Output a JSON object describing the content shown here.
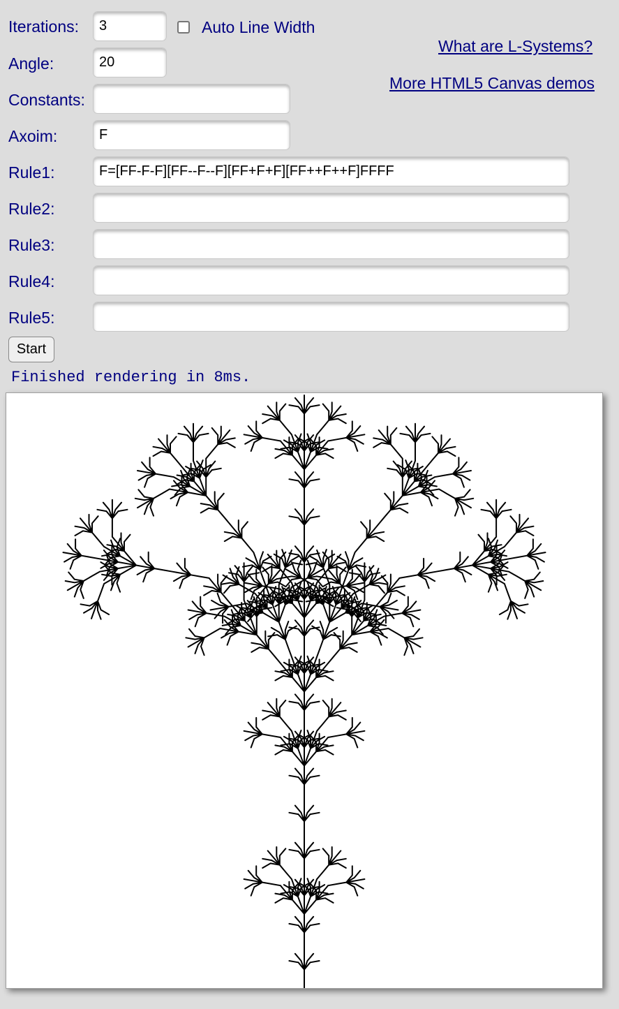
{
  "form": {
    "iterations": {
      "label": "Iterations:",
      "value": "3"
    },
    "angle": {
      "label": "Angle:",
      "value": "20"
    },
    "constants": {
      "label": "Constants:",
      "value": ""
    },
    "axiom": {
      "label": "Axoim:",
      "value": "F"
    },
    "rules": [
      {
        "label": "Rule1:",
        "value": "F=[FF-F-F][FF--F--F][FF+F+F][FF++F++F]FFFF"
      },
      {
        "label": "Rule2:",
        "value": ""
      },
      {
        "label": "Rule3:",
        "value": ""
      },
      {
        "label": "Rule4:",
        "value": ""
      },
      {
        "label": "Rule5:",
        "value": ""
      }
    ],
    "auto_line_width": {
      "label": "Auto Line Width",
      "checked": false
    },
    "start_button": "Start"
  },
  "links": {
    "what_are_lsystems": "What are L-Systems?",
    "more_demos": "More HTML5 Canvas demos"
  },
  "status": "Finished rendering in 8ms.",
  "canvas": {
    "stroke_color": "#000000",
    "background": "#ffffff"
  }
}
